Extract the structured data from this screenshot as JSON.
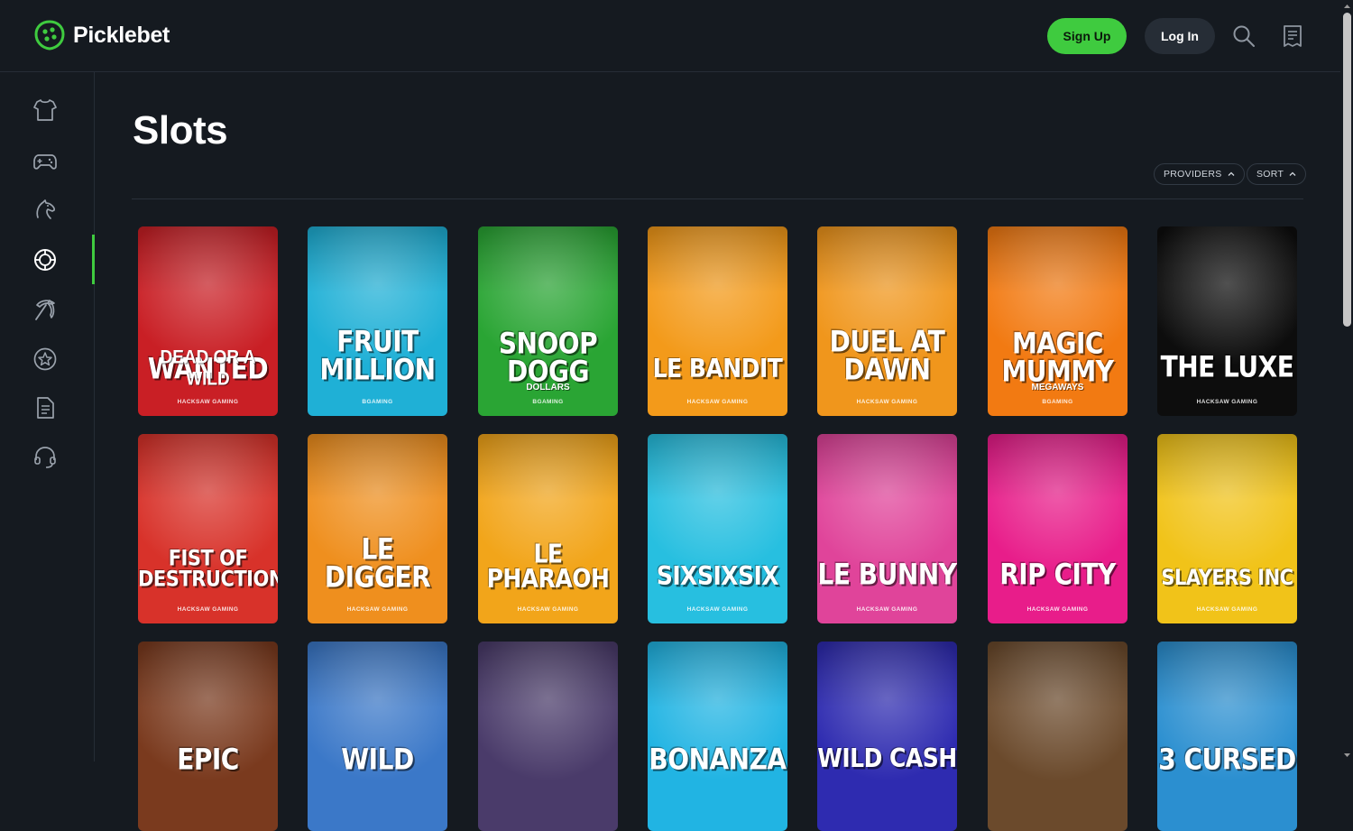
{
  "brand": {
    "name": "Picklebet",
    "accent": "#3fcb3f"
  },
  "header": {
    "signup_label": "Sign Up",
    "login_label": "Log In"
  },
  "sidebar": {
    "items": [
      {
        "icon": "jersey-icon"
      },
      {
        "icon": "gamepad-icon"
      },
      {
        "icon": "horse-icon"
      },
      {
        "icon": "casino-chip-icon",
        "active": true
      },
      {
        "icon": "pickaxe-icon"
      },
      {
        "icon": "star-circle-icon"
      },
      {
        "icon": "document-icon"
      },
      {
        "icon": "headset-icon"
      }
    ]
  },
  "main": {
    "title": "Slots",
    "providers_label": "PROVIDERS",
    "sort_label": "SORT"
  },
  "games": [
    {
      "name": "WANTED",
      "subtitle": "DEAD OR A WILD",
      "studio": "HACKSAW GAMING",
      "bg": "#c91f25"
    },
    {
      "name": "FRUIT\nMILLION",
      "subtitle": "",
      "studio": "BGAMING",
      "bg": "#1fb0d6"
    },
    {
      "name": "SNOOP\nDOGG",
      "subtitle": "DOLLARS",
      "studio": "BGAMING",
      "bg": "#2aa534"
    },
    {
      "name": "LE BANDIT",
      "subtitle": "",
      "studio": "HACKSAW GAMING",
      "bg": "#f39a1a"
    },
    {
      "name": "DUEL AT\nDAWN",
      "subtitle": "",
      "studio": "HACKSAW GAMING",
      "bg": "#f0961c"
    },
    {
      "name": "MAGIC\nMUMMY",
      "subtitle": "MEGAWAYS",
      "studio": "BGAMING",
      "bg": "#f27a12"
    },
    {
      "name": "THE LUXE",
      "subtitle": "",
      "studio": "HACKSAW GAMING",
      "bg": "#0d0d0d"
    },
    {
      "name": "FIST OF\nDESTRUCTION",
      "subtitle": "",
      "studio": "HACKSAW GAMING",
      "bg": "#d8322a"
    },
    {
      "name": "LE\nDIGGER",
      "subtitle": "",
      "studio": "HACKSAW GAMING",
      "bg": "#ef8f1e"
    },
    {
      "name": "LE PHARAOH",
      "subtitle": "",
      "studio": "HACKSAW GAMING",
      "bg": "#f2a51a"
    },
    {
      "name": "SIXSIXSIX",
      "subtitle": "",
      "studio": "HACKSAW GAMING",
      "bg": "#27bfe0"
    },
    {
      "name": "LE BUNNY",
      "subtitle": "",
      "studio": "HACKSAW GAMING",
      "bg": "#e0449a"
    },
    {
      "name": "RIP CITY",
      "subtitle": "",
      "studio": "HACKSAW GAMING",
      "bg": "#e81d8a"
    },
    {
      "name": "SLAYERS INC",
      "subtitle": "",
      "studio": "HACKSAW GAMING",
      "bg": "#f1c319"
    },
    {
      "name": "EPIC",
      "subtitle": "",
      "studio": "",
      "bg": "#7a3a1e"
    },
    {
      "name": "WILD",
      "subtitle": "",
      "studio": "",
      "bg": "#3b78c8"
    },
    {
      "name": "",
      "subtitle": "",
      "studio": "",
      "bg": "#4a3b6a"
    },
    {
      "name": "BONANZA",
      "subtitle": "",
      "studio": "",
      "bg": "#21b4e3"
    },
    {
      "name": "WILD CASH",
      "subtitle": "",
      "studio": "",
      "bg": "#2e2bb0"
    },
    {
      "name": "",
      "subtitle": "",
      "studio": "",
      "bg": "#6b4a2c"
    },
    {
      "name": "3 CURSED",
      "subtitle": "",
      "studio": "",
      "bg": "#2b8fd0"
    }
  ]
}
